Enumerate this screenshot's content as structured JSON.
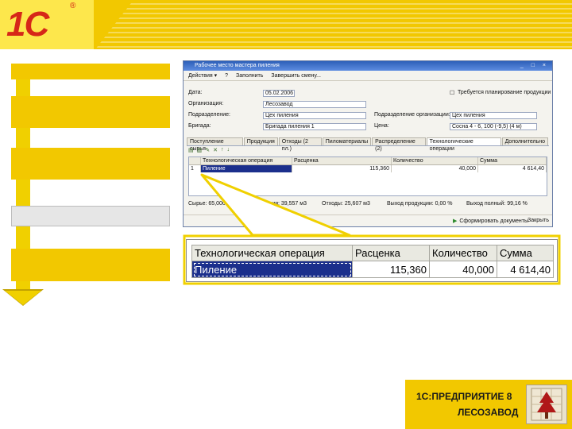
{
  "window": {
    "title": "Рабочее место мастера пиления",
    "controls": "_ □ ×",
    "toolbar": {
      "actions": "Действия ▾",
      "help": "?",
      "fill": "Заполнить",
      "complete": "Завершить смену..."
    },
    "fields": {
      "date_label": "Дата:",
      "date_value": "05.02.2006",
      "org_label": "Организация:",
      "org_value": "Лесозавод",
      "subdiv_label": "Подразделение:",
      "subdiv_value": "Цех пиления",
      "subdiv_org_label": "Подразделение организации:",
      "subdiv_org_value": "Цех пиления",
      "brigade_label": "Бригада:",
      "brigade_value": "Бригада пиления 1",
      "checkbox_label": "Требуется планирование продукции",
      "cost_label": "Цена:",
      "cost_value": "Сосна 4 - 6, 100 (-9,5) (4 м)"
    },
    "tabs": [
      "Поступление сырья",
      "Продукция",
      "Отходы (2 пл.)",
      "Пиломатериалы",
      "Распределение (2)",
      "Технологические операции",
      "Дополнительно"
    ],
    "grid": {
      "headers": [
        "",
        "Технологическая операция",
        "Расценка",
        "Количество",
        "Сумма"
      ],
      "row": {
        "num": "1",
        "op": "Пиление",
        "rate": "115,360",
        "qty": "40,000",
        "sum": "4 614,40"
      }
    },
    "summary": {
      "raw": "Сырье: 65,000 м3",
      "product": "Продукция: 39,557 м3",
      "waste": "Отходы: 25,607 м3",
      "output_pct": "Выход продукции: 0,00 %",
      "output_full": "Выход полный: 99,16 %"
    },
    "status": {
      "generate": "Сформировать документы",
      "close": "Закрыть"
    }
  },
  "zoom": {
    "headers": [
      "Технологическая операция",
      "Расценка",
      "Количество",
      "Сумма"
    ],
    "row": [
      "Пиление",
      "115,360",
      "40,000",
      "4 614,40"
    ]
  },
  "brand": {
    "line1": "1С:ПРЕДПРИЯТИЕ 8",
    "line2": "ЛЕСОЗАВОД"
  },
  "logo": {
    "text": "1С",
    "mark": "®"
  },
  "colors": {
    "accent_yellow": "#f2c800",
    "logo_red": "#d62718",
    "selection": "#1b2f8c"
  }
}
